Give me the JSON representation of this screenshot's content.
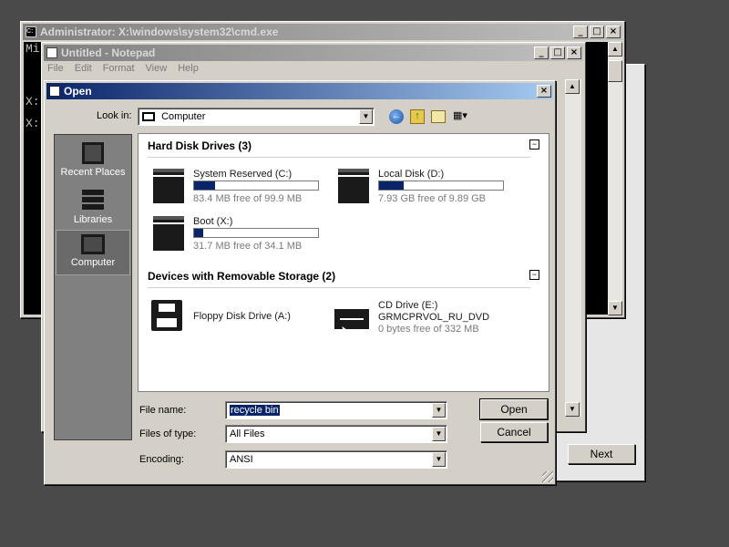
{
  "cmd_window": {
    "title": "Administrator: X:\\windows\\system32\\cmd.exe",
    "lines": [
      "Mi",
      "X:",
      "X:"
    ]
  },
  "notepad": {
    "title": "Untitled - Notepad",
    "menu": [
      "File",
      "Edit",
      "Format",
      "View",
      "Help"
    ]
  },
  "wizard": {
    "next_label": "Next"
  },
  "open_dialog": {
    "title": "Open",
    "look_in_label": "Look in:",
    "look_in_value": "Computer",
    "places": [
      "Recent Places",
      "Libraries",
      "Computer"
    ],
    "sections": [
      {
        "header": "Hard Disk Drives (3)",
        "collapse": "−"
      },
      {
        "header": "Devices with Removable Storage (2)",
        "collapse": "−"
      }
    ],
    "drives": [
      {
        "name": "System Reserved (C:)",
        "free": "83.4 MB free of 99.9 MB",
        "used_fraction": 0.17
      },
      {
        "name": "Local Disk (D:)",
        "free": "7.93 GB free of 9.89 GB",
        "used_fraction": 0.2
      },
      {
        "name": "Boot (X:)",
        "free": "31.7 MB free of 34.1 MB",
        "used_fraction": 0.07
      }
    ],
    "removable": [
      {
        "name": "Floppy Disk Drive (A:)"
      },
      {
        "name": "CD Drive (E:)",
        "label": "GRMCPRVOL_RU_DVD",
        "free": "0 bytes free of 332 MB"
      }
    ],
    "file_name_label": "File name:",
    "file_name_value": "recycle bin",
    "file_type_label": "Files of type:",
    "file_type_value": "All Files",
    "encoding_label": "Encoding:",
    "encoding_value": "ANSI",
    "open_label": "Open",
    "cancel_label": "Cancel"
  }
}
